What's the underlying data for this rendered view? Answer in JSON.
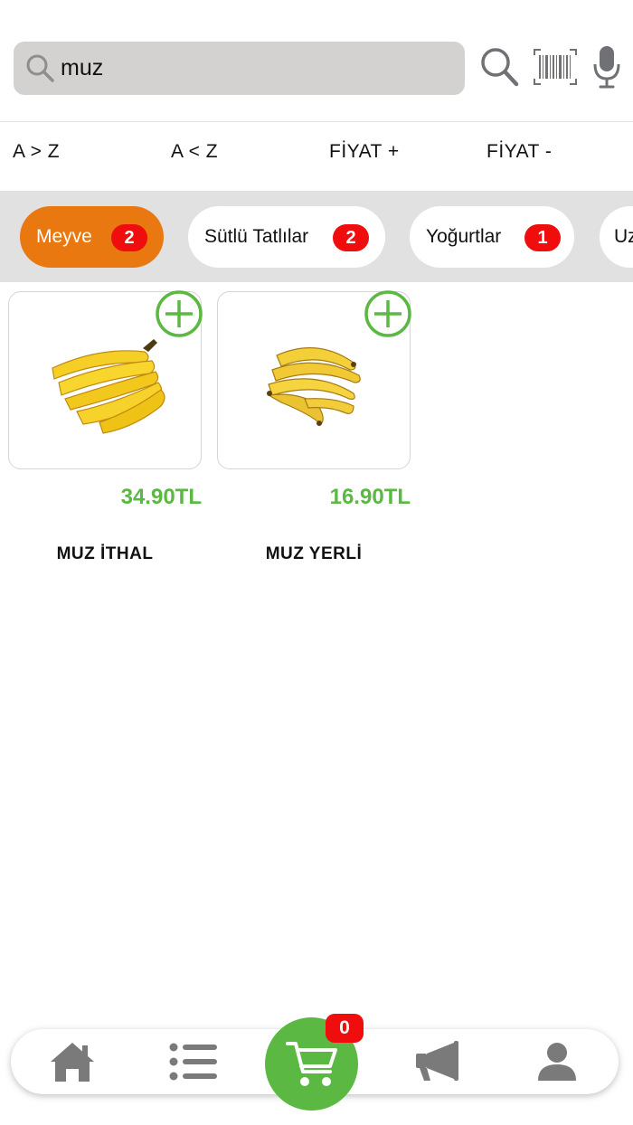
{
  "search": {
    "value": "muz",
    "placeholder": ""
  },
  "sort_options": [
    {
      "label": "A > Z"
    },
    {
      "label": "A < Z"
    },
    {
      "label": "FİYAT +"
    },
    {
      "label": "FİYAT -"
    }
  ],
  "categories": [
    {
      "label": "Meyve",
      "count": "2",
      "active": true
    },
    {
      "label": "Sütlü Tatlılar",
      "count": "2",
      "active": false
    },
    {
      "label": "Yoğurtlar",
      "count": "1",
      "active": false
    },
    {
      "label": "Uz",
      "count": "",
      "active": false
    }
  ],
  "products": [
    {
      "price": "34.90TL",
      "name": "MUZ İTHAL",
      "image": "banana-bunch-image"
    },
    {
      "price": "16.90TL",
      "name": "MUZ YERLİ",
      "image": "banana-bunch-image"
    }
  ],
  "bottom_nav": {
    "items": [
      {
        "icon": "home-icon"
      },
      {
        "icon": "list-icon"
      },
      {
        "icon": "cart-icon"
      },
      {
        "icon": "megaphone-icon"
      },
      {
        "icon": "user-icon"
      }
    ],
    "cart_count": "0"
  },
  "colors": {
    "accent_orange": "#e8780f",
    "accent_green": "#5bb842",
    "badge_red": "#ef0d0d",
    "search_bg": "#d3d2d1",
    "strip_bg": "#e1e1e1",
    "icon_gray": "#7a7a7a"
  }
}
